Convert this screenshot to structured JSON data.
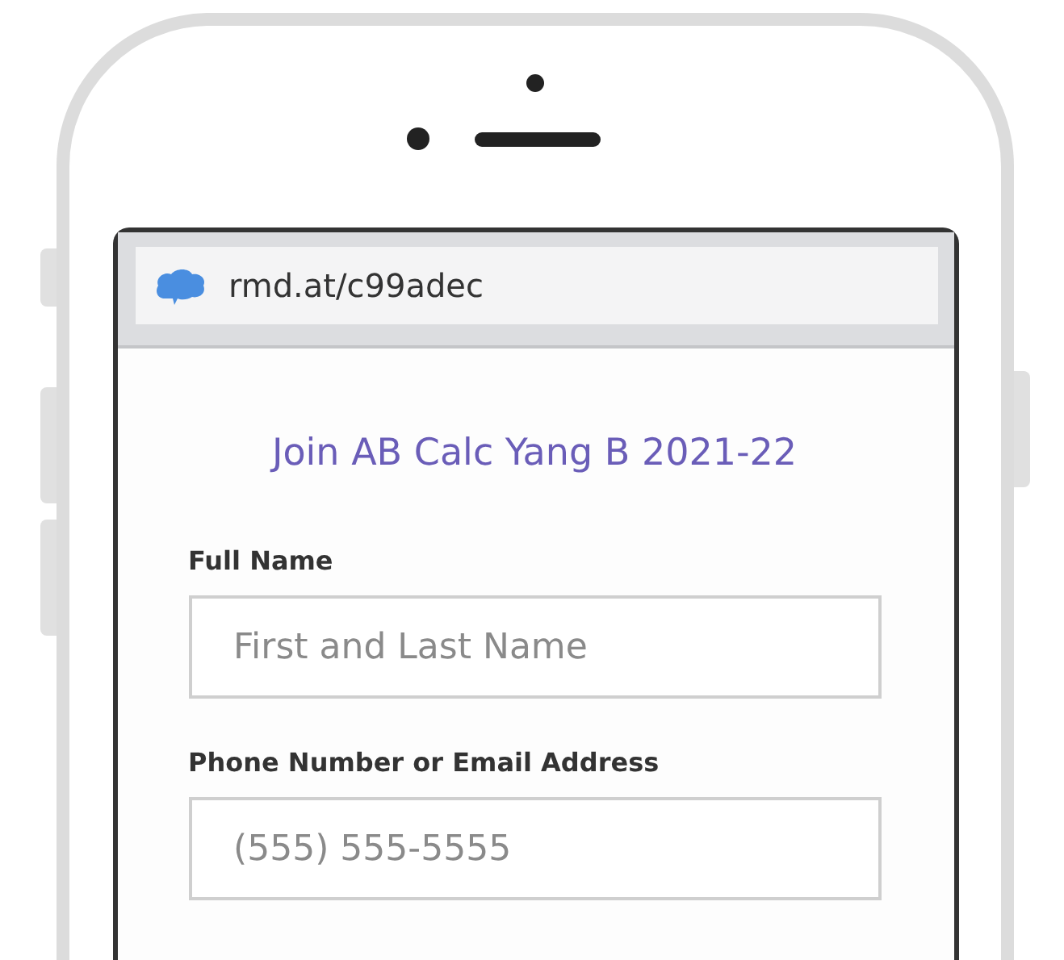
{
  "browser": {
    "url": "rmd.at/c99adec"
  },
  "form": {
    "title": "Join AB Calc Yang B 2021-22",
    "fields": [
      {
        "label": "Full Name",
        "placeholder": "First and Last Name"
      },
      {
        "label": "Phone Number or Email Address",
        "placeholder": "(555) 555-5555"
      }
    ]
  }
}
